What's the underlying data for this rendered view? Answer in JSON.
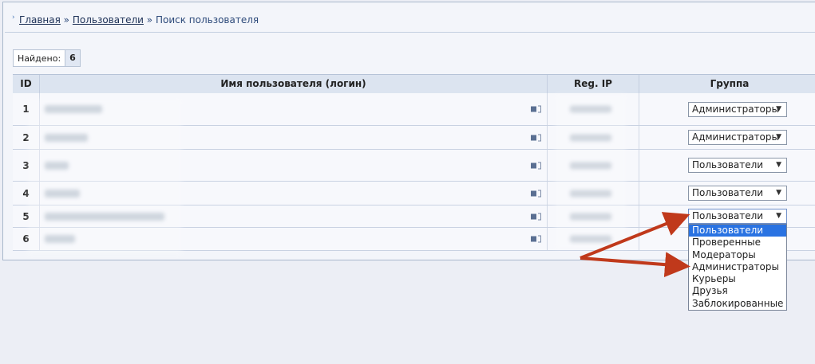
{
  "breadcrumb": {
    "home": "Главная",
    "sep1": "»",
    "users": "Пользователи",
    "sep2": "»",
    "current": "Поиск пользователя"
  },
  "found": {
    "label": "Найдено:",
    "value": "6"
  },
  "table": {
    "headers": {
      "id": "ID",
      "username": "Имя пользователя (логин)",
      "ip": "Reg. IP",
      "group": "Группа"
    },
    "rows": [
      {
        "id": "1",
        "group": "Администраторы"
      },
      {
        "id": "2",
        "group": "Администраторы"
      },
      {
        "id": "3",
        "group": "Пользователи"
      },
      {
        "id": "4",
        "group": "Пользователи"
      },
      {
        "id": "5",
        "group": "Пользователи"
      },
      {
        "id": "6",
        "group": ""
      }
    ]
  },
  "dropdown": {
    "selected": "Пользователи",
    "options": [
      "Пользователи",
      "Проверенные",
      "Модераторы",
      "Администраторы",
      "Курьеры",
      "Друзья",
      "Заблокированные"
    ]
  },
  "colors": {
    "highlight": "#2a73e2",
    "annotation_arrow": "#c0391b"
  }
}
